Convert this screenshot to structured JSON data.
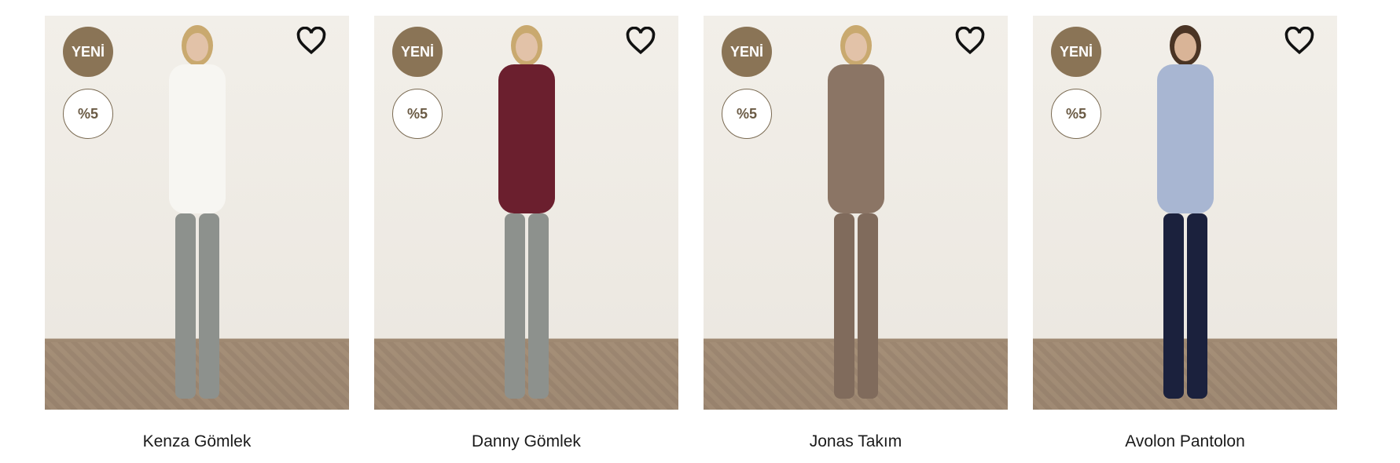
{
  "colors": {
    "badge": "#8a7456",
    "heart": "#111111"
  },
  "products": [
    {
      "name": "Kenza Gömlek",
      "badge_new": "YENİ",
      "discount": "%5",
      "top": "#f7f6f2",
      "bottom": "#8d918d",
      "skin": "#e2c2a8",
      "hair": "#c9a96f"
    },
    {
      "name": "Danny Gömlek",
      "badge_new": "YENİ",
      "discount": "%5",
      "top": "#6b1f2e",
      "bottom": "#8d918d",
      "skin": "#e2c2a8",
      "hair": "#c9a96f"
    },
    {
      "name": "Jonas Takım",
      "badge_new": "YENİ",
      "discount": "%5",
      "top": "#8b7565",
      "bottom": "#806b5c",
      "skin": "#e2c2a8",
      "hair": "#c9a96f"
    },
    {
      "name": "Avolon Pantolon",
      "badge_new": "YENİ",
      "discount": "%5",
      "top": "#a8b6d2",
      "bottom": "#1b213d",
      "skin": "#d9b497",
      "hair": "#4a3424"
    }
  ]
}
